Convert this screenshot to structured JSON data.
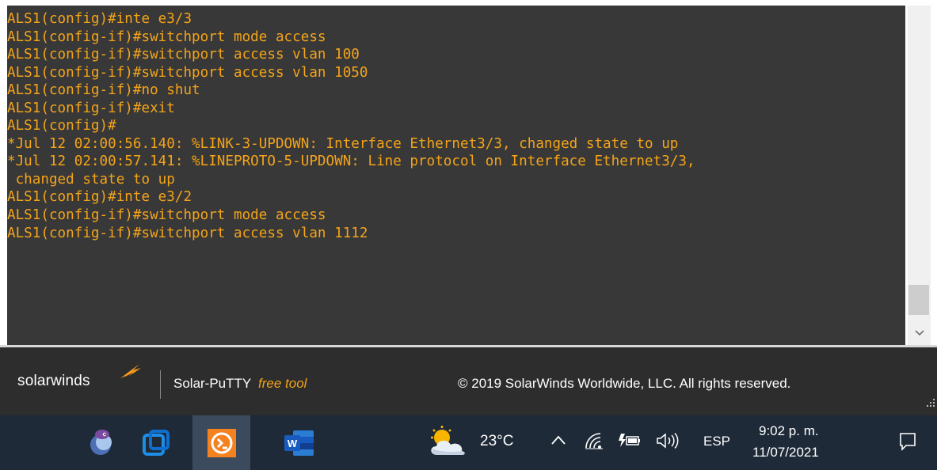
{
  "terminal": {
    "lines": [
      "ALS1(config)#inte e3/3",
      "ALS1(config-if)#switchport mode access",
      "ALS1(config-if)#switchport access vlan 100",
      "ALS1(config-if)#switchport access vlan 1050",
      "ALS1(config-if)#no shut",
      "ALS1(config-if)#exit",
      "ALS1(config)#",
      "*Jul 12 02:00:56.140: %LINK-3-UPDOWN: Interface Ethernet3/3, changed state to up",
      "*Jul 12 02:00:57.141: %LINEPROTO-5-UPDOWN: Line protocol on Interface Ethernet3/3,",
      " changed state to up",
      "ALS1(config)#inte e3/2",
      "ALS1(config-if)#switchport mode access",
      "ALS1(config-if)#switchport access vlan 1112"
    ],
    "text_color": "#f4a419",
    "background": "#383838"
  },
  "footer": {
    "logo": "solarwinds",
    "product": "Solar-PuTTY",
    "free_label": "free tool",
    "copyright": "© 2019 SolarWinds Worldwide, LLC. All rights reserved."
  },
  "taskbar": {
    "apps": [
      "eclipse-icon",
      "virtualbox-icon",
      "solar-putty-icon",
      "word-icon"
    ],
    "active_app": "solar-putty-icon",
    "weather": {
      "icon": "partly-cloudy-icon",
      "temperature": "23°C"
    },
    "tray_icons": [
      "chevron-up-icon",
      "wifi-icon",
      "battery-icon",
      "volume-icon"
    ],
    "language": "ESP",
    "time": "9:02 p. m.",
    "date": "11/07/2021"
  }
}
